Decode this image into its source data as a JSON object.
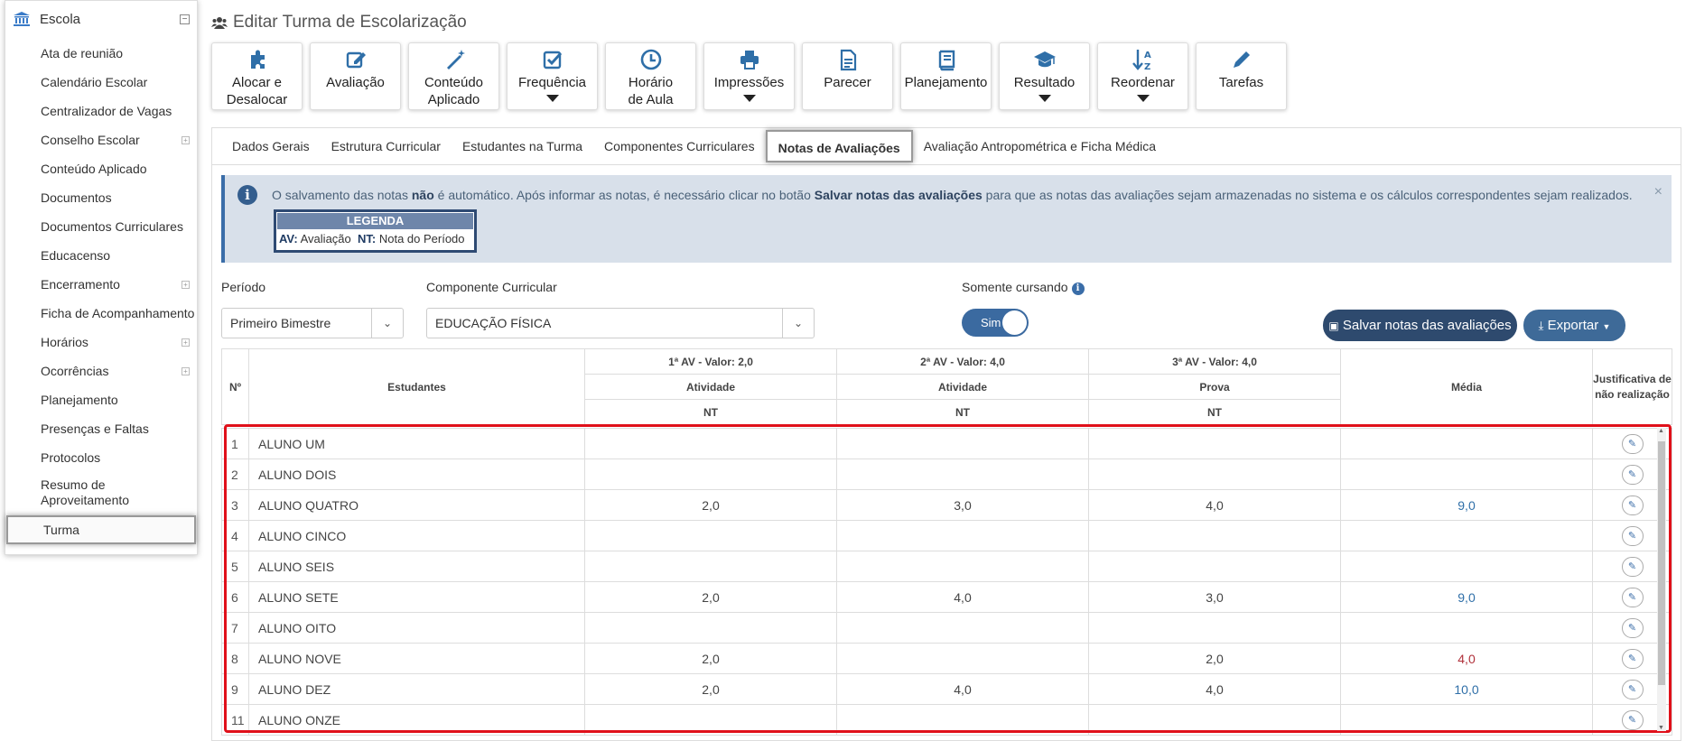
{
  "sidebar": {
    "title": "Escola",
    "items": [
      {
        "label": "Ata de reunião",
        "expandable": false
      },
      {
        "label": "Calendário Escolar",
        "expandable": false
      },
      {
        "label": "Centralizador de Vagas",
        "expandable": false
      },
      {
        "label": "Conselho Escolar",
        "expandable": true
      },
      {
        "label": "Conteúdo Aplicado",
        "expandable": false
      },
      {
        "label": "Documentos",
        "expandable": false
      },
      {
        "label": "Documentos Curriculares",
        "expandable": false
      },
      {
        "label": "Educacenso",
        "expandable": false
      },
      {
        "label": "Encerramento",
        "expandable": true
      },
      {
        "label": "Ficha de Acompanhamento",
        "expandable": false
      },
      {
        "label": "Horários",
        "expandable": true
      },
      {
        "label": "Ocorrências",
        "expandable": true
      },
      {
        "label": "Planejamento",
        "expandable": false
      },
      {
        "label": "Presenças e Faltas",
        "expandable": false
      },
      {
        "label": "Protocolos",
        "expandable": false
      },
      {
        "label": "Resumo de Aproveitamento",
        "expandable": false
      },
      {
        "label": "Turma",
        "expandable": false,
        "active": true
      }
    ]
  },
  "page": {
    "title": "Editar Turma de Escolarização"
  },
  "toolbar": [
    {
      "label": "Alocar e Desalocar",
      "icon": "puzzle-icon",
      "dropdown": false
    },
    {
      "label": "Avaliação",
      "icon": "edit-icon",
      "dropdown": false
    },
    {
      "label": "Conteúdo Aplicado",
      "icon": "magic-wand-icon",
      "dropdown": false
    },
    {
      "label": "Frequência",
      "icon": "check-square-icon",
      "dropdown": true
    },
    {
      "label": "Horário de Aula",
      "icon": "clock-icon",
      "dropdown": false
    },
    {
      "label": "Impressões",
      "icon": "printer-icon",
      "dropdown": true
    },
    {
      "label": "Parecer",
      "icon": "document-icon",
      "dropdown": false
    },
    {
      "label": "Planejamento",
      "icon": "book-icon",
      "dropdown": false
    },
    {
      "label": "Resultado",
      "icon": "graduation-cap-icon",
      "dropdown": true
    },
    {
      "label": "Reordenar",
      "icon": "sort-alpha-icon",
      "dropdown": true
    },
    {
      "label": "Tarefas",
      "icon": "pencil-icon",
      "dropdown": false
    }
  ],
  "tabs": [
    {
      "label": "Dados Gerais",
      "active": false
    },
    {
      "label": "Estrutura Curricular",
      "active": false
    },
    {
      "label": "Estudantes na Turma",
      "active": false
    },
    {
      "label": "Componentes Curriculares",
      "active": false
    },
    {
      "label": "Notas de Avaliações",
      "active": true
    },
    {
      "label": "Avaliação Antropométrica e Ficha Médica",
      "active": false
    }
  ],
  "alert": {
    "text_1": "O salvamento das notas ",
    "bold_1": "não",
    "text_2": " é automático. Após informar as notas, é necessário clicar no botão ",
    "bold_2": "Salvar notas das avaliações",
    "text_3": " para que as notas das avaliações sejam armazenadas no sistema e os cálculos correspondentes sejam realizados.",
    "close": "×",
    "legend_title": "LEGENDA",
    "legend_av_key": "AV:",
    "legend_av_val": "Avaliação",
    "legend_nt_key": "NT:",
    "legend_nt_val": "Nota do Período"
  },
  "filters": {
    "periodo_label": "Período",
    "periodo_value": "Primeiro Bimestre",
    "componente_label": "Componente Curricular",
    "componente_value": "EDUCAÇÃO FÍSICA",
    "cursando_label": "Somente cursando",
    "cursando_value": "Sim",
    "save_label": "Salvar notas das avaliações",
    "export_label": "Exportar"
  },
  "table": {
    "col_num": "Nº",
    "col_students": "Estudantes",
    "av1_header": "1ª AV - Valor: 2,0",
    "av1_type": "Atividade",
    "av1_nt": "NT",
    "av2_header": "2ª AV - Valor: 4,0",
    "av2_type": "Atividade",
    "av2_nt": "NT",
    "av3_header": "3ª AV - Valor: 4,0",
    "av3_type": "Prova",
    "av3_nt": "NT",
    "col_media": "Média",
    "col_justificativa": "Justificativa de não realização",
    "rows": [
      {
        "num": "1",
        "name": "ALUNO UM",
        "av1": "",
        "av2": "",
        "av3": "",
        "media": "",
        "low": false
      },
      {
        "num": "2",
        "name": "ALUNO DOIS",
        "av1": "",
        "av2": "",
        "av3": "",
        "media": "",
        "low": false
      },
      {
        "num": "3",
        "name": "ALUNO QUATRO",
        "av1": "2,0",
        "av2": "3,0",
        "av3": "4,0",
        "media": "9,0",
        "low": false
      },
      {
        "num": "4",
        "name": "ALUNO CINCO",
        "av1": "",
        "av2": "",
        "av3": "",
        "media": "",
        "low": false
      },
      {
        "num": "5",
        "name": "ALUNO SEIS",
        "av1": "",
        "av2": "",
        "av3": "",
        "media": "",
        "low": false
      },
      {
        "num": "6",
        "name": "ALUNO SETE",
        "av1": "2,0",
        "av2": "4,0",
        "av3": "3,0",
        "media": "9,0",
        "low": false
      },
      {
        "num": "7",
        "name": "ALUNO OITO",
        "av1": "",
        "av2": "",
        "av3": "",
        "media": "",
        "low": false
      },
      {
        "num": "8",
        "name": "ALUNO NOVE",
        "av1": "2,0",
        "av2": "",
        "av3": "2,0",
        "media": "4,0",
        "low": true
      },
      {
        "num": "9",
        "name": "ALUNO DEZ",
        "av1": "2,0",
        "av2": "4,0",
        "av3": "4,0",
        "media": "10,0",
        "low": false
      },
      {
        "num": "11",
        "name": "ALUNO ONZE",
        "av1": "",
        "av2": "",
        "av3": "",
        "media": "",
        "low": false
      }
    ]
  },
  "colors": {
    "accent": "#3a6da8",
    "dark": "#2e4a6e",
    "highlight": "#e0101a",
    "low_grade": "#b0303a"
  }
}
